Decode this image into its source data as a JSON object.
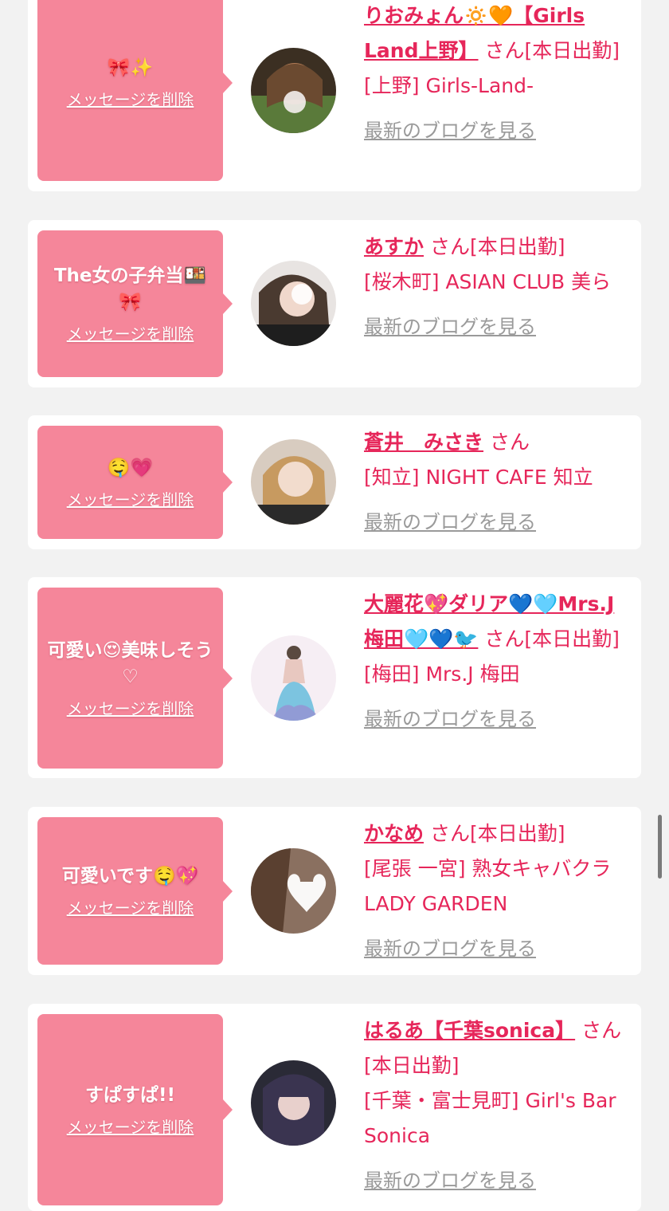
{
  "colors": {
    "background": "#f2f2f2",
    "bubble": "#f5869a",
    "name": "#e6265a",
    "blog_link": "#9a9a9a"
  },
  "cards": [
    {
      "message": "🎀✨",
      "delete_label": "メッセージを削除",
      "name": "りおみょん🔅🧡【Girls Land上野】",
      "san": "さん[本日出勤]",
      "shop": "[上野] Girls-Land-",
      "blog_label": "最新のブログを見る"
    },
    {
      "message": "The女の子弁当🍱🎀",
      "delete_label": "メッセージを削除",
      "name": "あすか",
      "san": "さん[本日出勤]",
      "shop": "[桜木町] ASIAN CLUB 美ら",
      "blog_label": "最新のブログを見る"
    },
    {
      "message": "🤤💗",
      "delete_label": "メッセージを削除",
      "name": "蒼井　みさき",
      "san": "さん",
      "shop": "[知立] NIGHT CAFE 知立",
      "blog_label": "最新のブログを見る"
    },
    {
      "message": "可愛い😍美味しそう♡",
      "delete_label": "メッセージを削除",
      "name": "大麗花💖ダリア💙🩵Mrs.J 梅田🩵💙🐦",
      "san": "さん[本日出勤]",
      "shop": "[梅田] Mrs.J 梅田",
      "blog_label": "最新のブログを見る"
    },
    {
      "message": "可愛いです🤤💖",
      "delete_label": "メッセージを削除",
      "name": "かなめ",
      "san": "さん[本日出勤]",
      "shop": "[尾張 一宮] 熟女キャバクラ LADY GARDEN",
      "blog_label": "最新のブログを見る"
    },
    {
      "message": "すぱすぱ!!",
      "delete_label": "メッセージを削除",
      "name": "はるあ【千葉sonica】",
      "san": "さん[本日出勤]",
      "shop": "[千葉・富士見町] Girl's Bar Sonica",
      "blog_label": "最新のブログを見る"
    }
  ]
}
